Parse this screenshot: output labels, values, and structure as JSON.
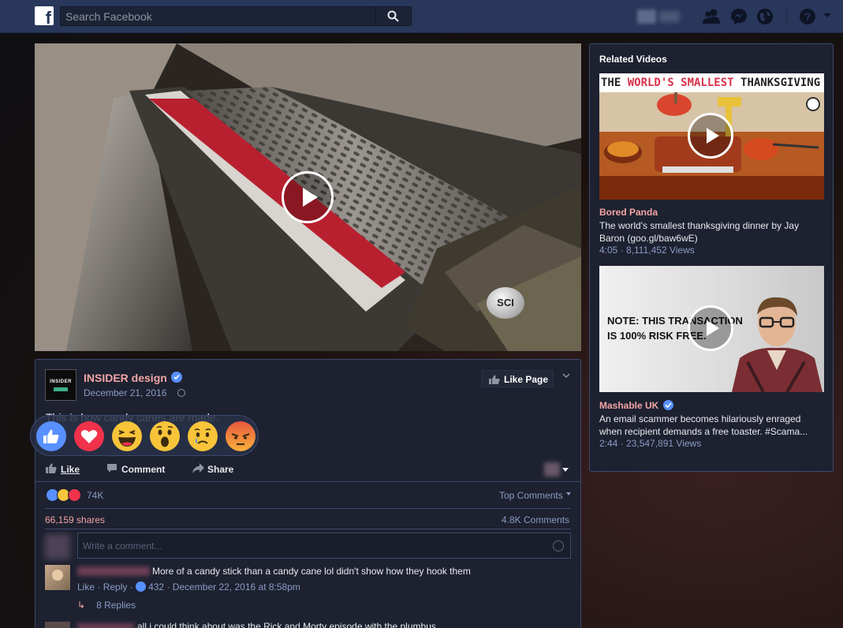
{
  "topbar": {
    "logo": "f",
    "search_placeholder": "Search Facebook",
    "icons": [
      "friends-icon",
      "messenger-icon",
      "globe-notifications-icon",
      "help-icon",
      "chevron-down-icon"
    ]
  },
  "video": {
    "watermark": "SCI"
  },
  "post": {
    "page_name": "INSIDER design",
    "avatar_text": "INSIDER",
    "date": "December 21, 2016",
    "like_page_label": "Like Page",
    "text": "This is how candy canes are made.",
    "actions": {
      "like": "Like",
      "comment": "Comment",
      "share": "Share"
    },
    "reaction_count": "74K",
    "top_comments_label": "Top Comments",
    "shares": "66,159 shares",
    "comments_count": "4.8K Comments",
    "comment_placeholder": "Write a comment...",
    "comments": [
      {
        "text": "More of a candy stick than a candy cane lol didn't show how they hook them",
        "like_link": "Like",
        "reply_link": "Reply",
        "likes": "432",
        "date": "December 22, 2016 at 8:58pm",
        "replies_label": "8 Replies"
      },
      {
        "text": "all i could think about was the Rick and Morty episode with the plumbus"
      }
    ]
  },
  "reactions": [
    "like",
    "love",
    "haha",
    "wow",
    "sad",
    "angry"
  ],
  "related": {
    "title": "Related Videos",
    "videos": [
      {
        "banner_plain_1": "THE ",
        "banner_red": "WORLD'S SMALLEST ",
        "banner_plain_2": "THANKSGIVING DINNER",
        "source": "Bored Panda",
        "description": "The world's smallest thanksgiving dinner by Jay Baron (goo.gl/baw6wE)",
        "meta": "4:05 · 8,111,452 Views"
      },
      {
        "thumb_line_1": "NOTE: THIS TRANSACTION",
        "thumb_line_2": "IS 100% RISK FREE.",
        "source": "Mashable UK",
        "description": "An email scammer becomes hilariously enraged when recipient demands a free toaster. #Scama...",
        "meta": "2:44 · 23,547,891 Views"
      }
    ]
  },
  "colors": {
    "topbar": "#28375a",
    "card_bg": "#1d2130",
    "card_border": "#3d4a6e",
    "accent_pink": "#f3a5a5",
    "meta_blue": "#8b9bc4",
    "verified_blue": "#5890ff"
  }
}
